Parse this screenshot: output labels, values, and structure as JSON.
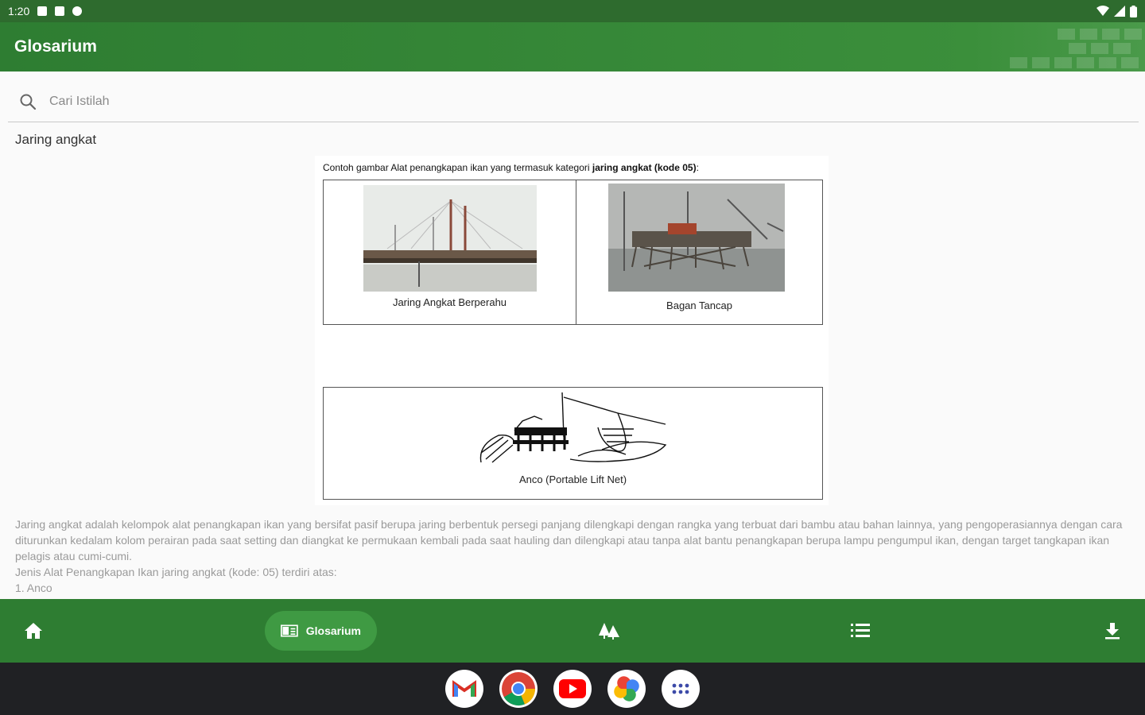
{
  "status": {
    "time": "1:20"
  },
  "app_bar": {
    "title": "Glosarium"
  },
  "search": {
    "placeholder": "Cari Istilah",
    "value": ""
  },
  "term": {
    "title": "Jaring angkat"
  },
  "figure": {
    "caption_prefix": "Contoh gambar Alat penangkapan ikan yang termasuk kategori ",
    "caption_bold": "jaring angkat (kode 05)",
    "caption_suffix": ":",
    "items": [
      {
        "label": "Jaring Angkat Berperahu"
      },
      {
        "label": "Bagan Tancap"
      },
      {
        "label": "Anco (Portable Lift Net)"
      }
    ]
  },
  "description": {
    "lines": [
      "Jaring angkat adalah kelompok alat penangkapan ikan yang bersifat pasif berupa jaring berbentuk persegi panjang dilengkapi dengan rangka yang terbuat dari bambu atau bahan lainnya, yang pengoperasiannya dengan cara diturunkan kedalam kolom perairan pada saat setting dan diangkat ke permukaan kembali pada saat hauling dan dilengkapi atau tanpa alat bantu penangkapan berupa lampu pengumpul ikan, dengan target tangkapan ikan pelagis atau cumi-cumi.",
      "Jenis Alat Penangkapan Ikan jaring angkat (kode: 05) terdiri atas:",
      "1. Anco"
    ]
  },
  "bottom_nav": {
    "items": [
      {
        "icon": "home-icon",
        "label": ""
      },
      {
        "icon": "book-icon",
        "label": "Glosarium"
      },
      {
        "icon": "trees-icon",
        "label": ""
      },
      {
        "icon": "list-icon",
        "label": ""
      },
      {
        "icon": "download-icon",
        "label": ""
      }
    ]
  },
  "taskbar": {
    "apps": [
      "gmail-icon",
      "chrome-icon",
      "youtube-icon",
      "photos-icon",
      "app-drawer-icon"
    ]
  },
  "colors": {
    "status_bar": "#2e6b2e",
    "primary": "#2e7d32",
    "nav_pill": "#3f9a43",
    "taskbar": "#202124"
  }
}
